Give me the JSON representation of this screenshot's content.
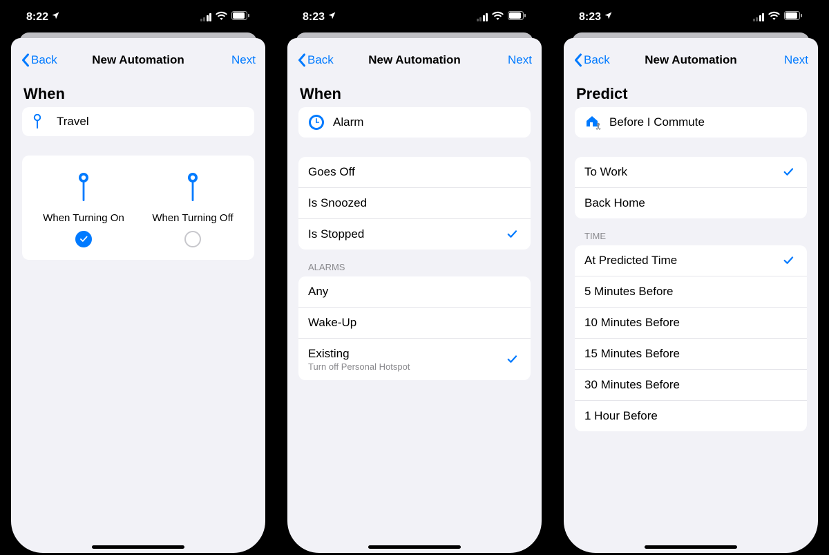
{
  "screens": [
    {
      "statusbar": {
        "time": "8:22"
      },
      "nav": {
        "back": "Back",
        "title": "New Automation",
        "next": "Next"
      },
      "sectionTitle": "When",
      "header": {
        "icon": "pin",
        "label": "Travel"
      },
      "chooser": {
        "left": {
          "label": "When Turning On",
          "selected": true
        },
        "right": {
          "label": "When Turning Off",
          "selected": false
        }
      }
    },
    {
      "statusbar": {
        "time": "8:23"
      },
      "nav": {
        "back": "Back",
        "title": "New Automation",
        "next": "Next"
      },
      "sectionTitle": "When",
      "header": {
        "icon": "clock",
        "label": "Alarm"
      },
      "triggers": [
        {
          "label": "Goes Off",
          "checked": false
        },
        {
          "label": "Is Snoozed",
          "checked": false
        },
        {
          "label": "Is Stopped",
          "checked": true
        }
      ],
      "alarmsGroupLabel": "ALARMS",
      "alarms": [
        {
          "label": "Any",
          "checked": false
        },
        {
          "label": "Wake-Up",
          "checked": false
        },
        {
          "label": "Existing",
          "sub": "Turn off Personal Hotspot",
          "checked": true
        }
      ]
    },
    {
      "statusbar": {
        "time": "8:23"
      },
      "nav": {
        "back": "Back",
        "title": "New Automation",
        "next": "Next"
      },
      "sectionTitle": "Predict",
      "header": {
        "icon": "commute",
        "label": "Before I Commute"
      },
      "destinations": [
        {
          "label": "To Work",
          "checked": true
        },
        {
          "label": "Back Home",
          "checked": false
        }
      ],
      "timeGroupLabel": "TIME",
      "times": [
        {
          "label": "At Predicted Time",
          "checked": true
        },
        {
          "label": "5 Minutes Before",
          "checked": false
        },
        {
          "label": "10 Minutes Before",
          "checked": false
        },
        {
          "label": "15 Minutes Before",
          "checked": false
        },
        {
          "label": "30 Minutes Before",
          "checked": false
        },
        {
          "label": "1 Hour Before",
          "checked": false
        }
      ]
    }
  ]
}
